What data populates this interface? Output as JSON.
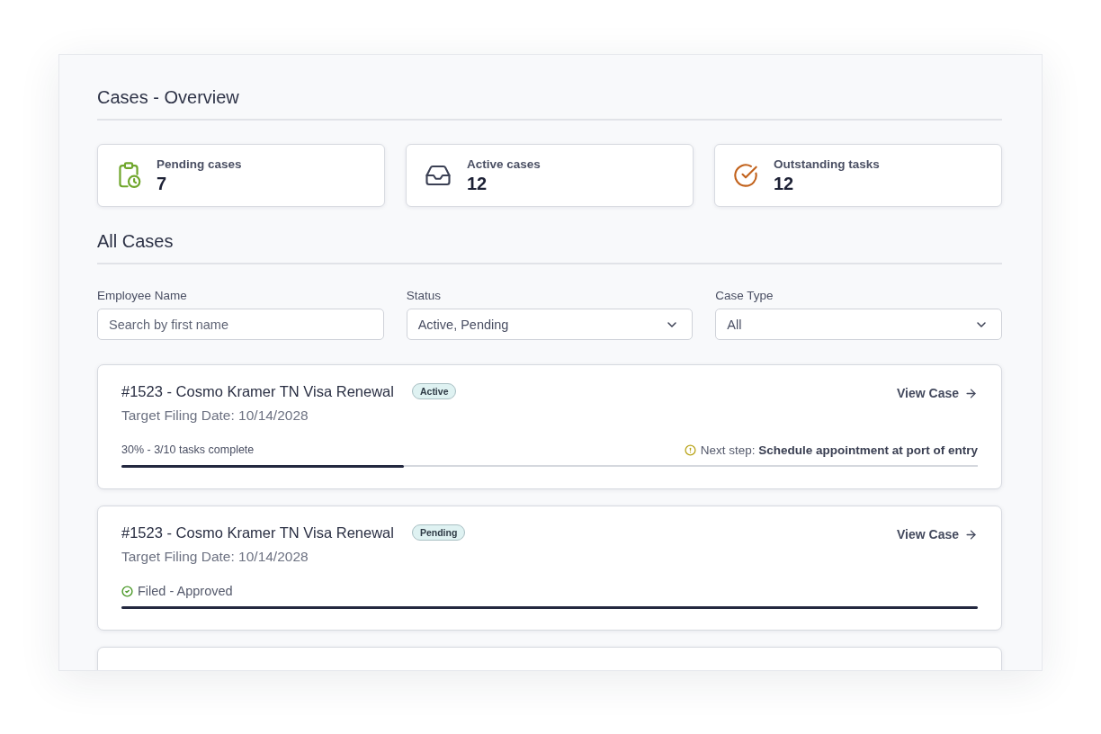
{
  "page_title": "Cases - Overview",
  "stats": [
    {
      "kind": "pending",
      "label": "Pending cases",
      "value": "7"
    },
    {
      "kind": "active",
      "label": "Active cases",
      "value": "12"
    },
    {
      "kind": "tasks",
      "label": "Outstanding tasks",
      "value": "12"
    }
  ],
  "section_title": "All Cases",
  "filters": [
    {
      "kind": "search",
      "label": "Employee Name",
      "placeholder": "Search by first name"
    },
    {
      "kind": "select",
      "label": "Status",
      "value": "Active, Pending"
    },
    {
      "kind": "select",
      "label": "Case Type",
      "value": "All"
    }
  ],
  "cases": [
    {
      "kind": "progress",
      "title": "#1523 - Cosmo Kramer TN Visa Renewal",
      "status": "Active",
      "target_date": "Target Filing Date: 10/14/2028",
      "link": "View Case",
      "progress_text": "30% - 3/10 tasks complete",
      "next_step": "Next step: **Schedule appointment at port of entry**",
      "level": 0.33
    },
    {
      "kind": "filed",
      "title": "#1523 - Cosmo Kramer TN Visa Renewal",
      "status": "Pending",
      "target_date": "Target Filing Date: 10/14/2028",
      "link": "View Case",
      "status_text": "Filed - Approved",
      "level": 1
    }
  ]
}
